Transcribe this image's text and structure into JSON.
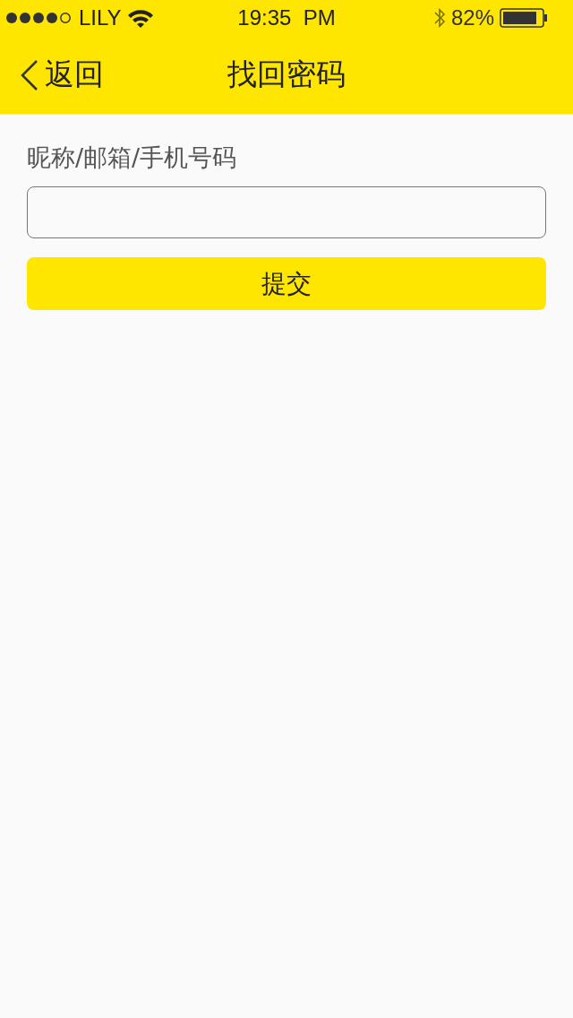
{
  "status_bar": {
    "carrier": "LILY",
    "time": "19:35  PM",
    "battery": "82%"
  },
  "nav_bar": {
    "back": "返回",
    "title": "找回密码"
  },
  "form": {
    "label": "昵称/邮箱/手机号码",
    "submit": "提交"
  }
}
